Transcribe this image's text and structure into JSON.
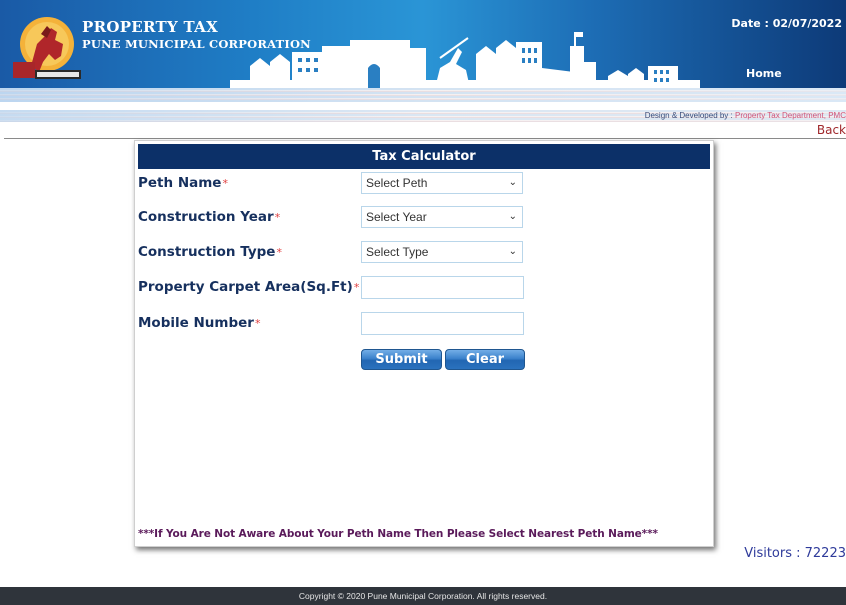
{
  "header": {
    "title": "PROPERTY TAX",
    "subtitle": "PUNE MUNICIPAL CORPORATION",
    "date_label": "Date : 02/07/2022",
    "home_link": "Home",
    "logo": "pmc-emblem-logo",
    "colors": {
      "banner_dark": "#0d3a78",
      "banner_light": "#2a95d6"
    }
  },
  "credit": {
    "prefix": "Design & Developed by : ",
    "dept": "Property Tax Department, PMC"
  },
  "back_link": "Back",
  "calculator": {
    "title": "Tax Calculator",
    "required_mark": "*",
    "fields": [
      {
        "label": "Peth Name",
        "type": "select",
        "value": "Select Peth"
      },
      {
        "label": "Construction Year",
        "type": "select",
        "value": "Select Year"
      },
      {
        "label": "Construction Type",
        "type": "select",
        "value": "Select Type"
      },
      {
        "label": "Property Carpet Area(Sq.Ft)",
        "type": "text",
        "value": "",
        "placeholder": ""
      },
      {
        "label": "Mobile Number",
        "type": "text",
        "value": "",
        "placeholder": ""
      }
    ],
    "submit_label": "Submit",
    "clear_label": "Clear",
    "note": "***If You Are Not Aware About Your Peth Name Then Please Select Nearest Peth Name***",
    "colors": {
      "header_bg": "#0c3068",
      "label": "#16305e",
      "required": "#e04040",
      "note": "#5a1a5a"
    }
  },
  "visitors": "Visitors : 72223",
  "footer": {
    "copyright": "Copyright © 2020 Pune Municipal Corporation. All rights reserved."
  }
}
